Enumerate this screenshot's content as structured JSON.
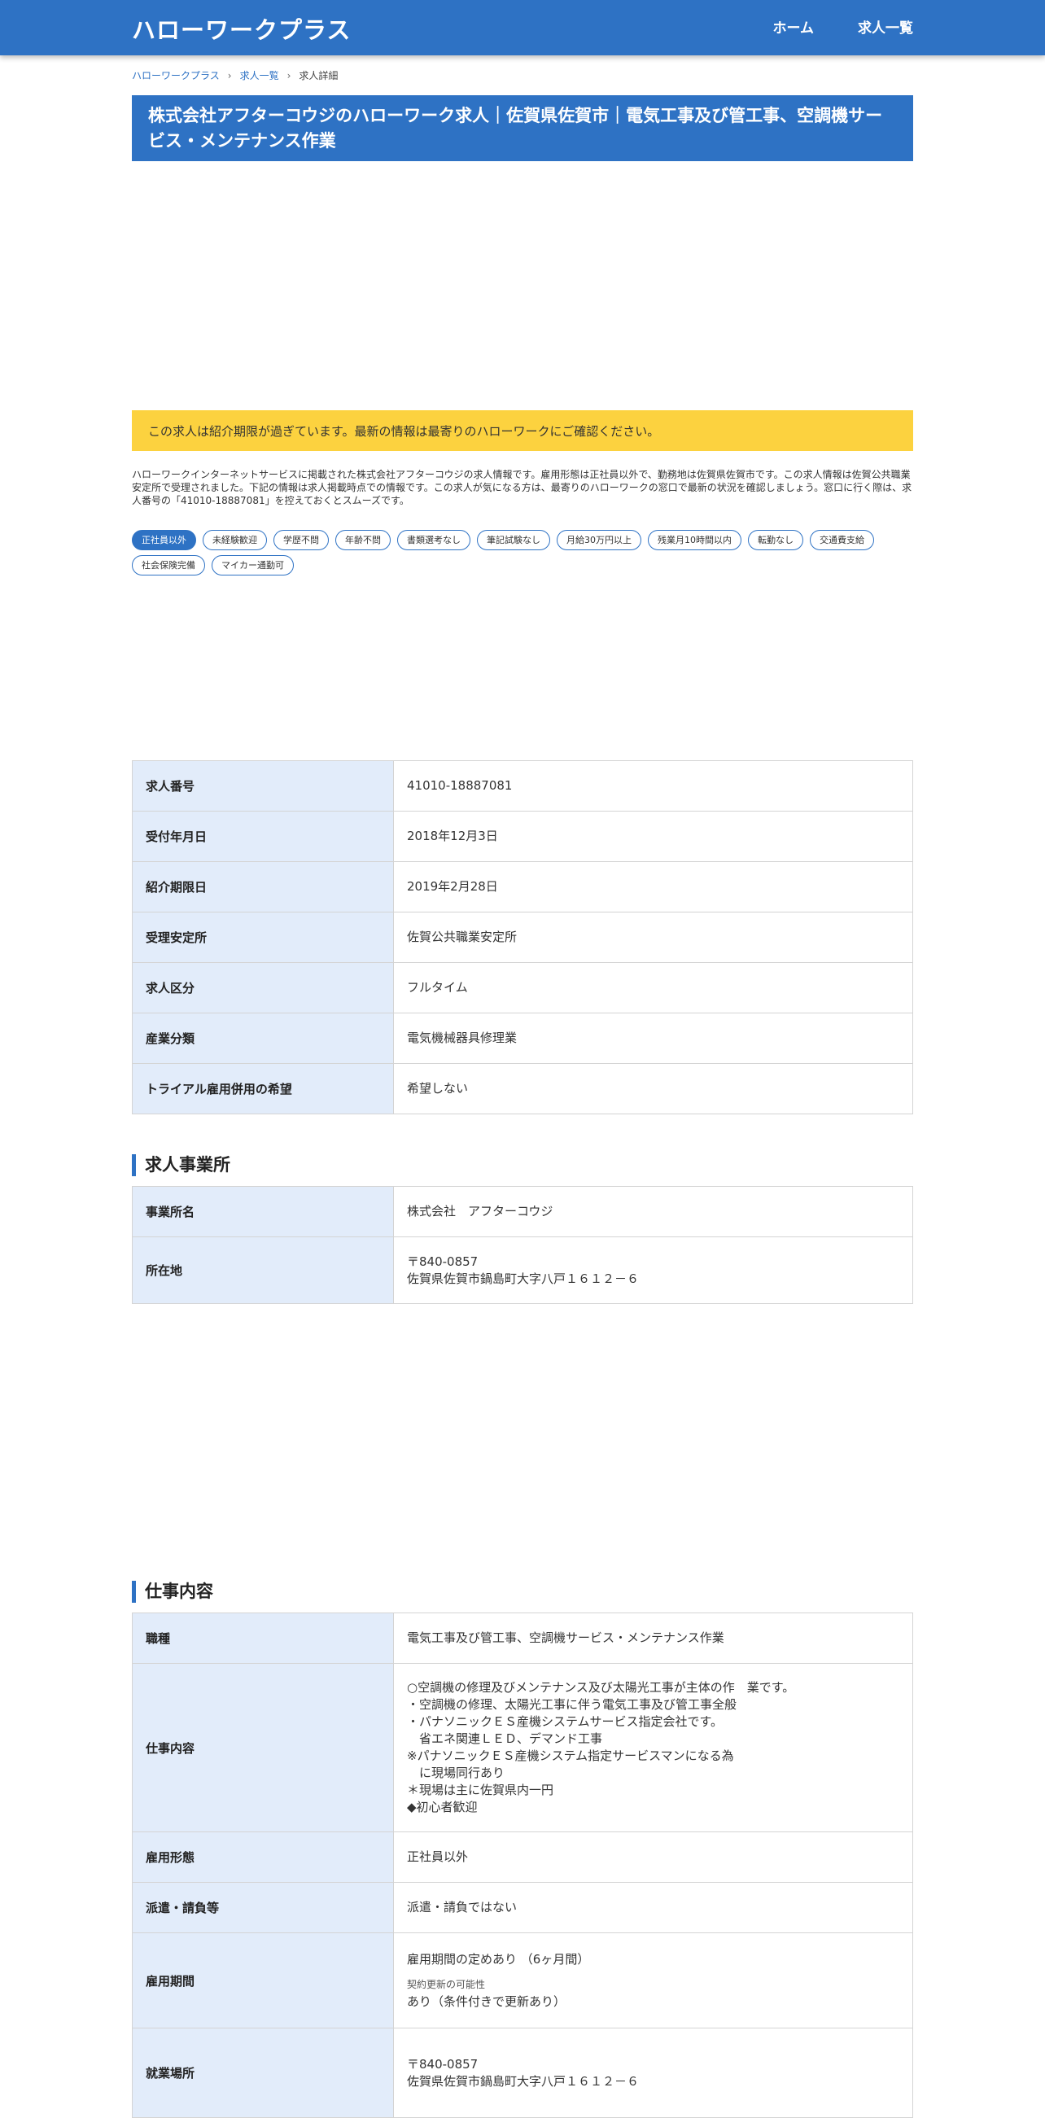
{
  "header": {
    "brand": "ハローワークプラス",
    "nav": [
      "ホーム",
      "求人一覧"
    ]
  },
  "breadcrumb": [
    "ハローワークプラス",
    "求人一覧",
    "求人詳細"
  ],
  "title": "株式会社アフターコウジのハローワーク求人｜佐賀県佐賀市｜電気工事及び管工事、空調機サービス・メンテナンス作業",
  "notice": "この求人は紹介期限が過ぎています。最新の情報は最寄りのハローワークにご確認ください。",
  "description": "ハローワークインターネットサービスに掲載された株式会社アフターコウジの求人情報です。雇用形態は正社員以外で、勤務地は佐賀県佐賀市です。この求人情報は佐賀公共職業安定所で受理されました。下記の情報は求人掲載時点での情報です。この求人が気になる方は、最寄りのハローワークの窓口で最新の状況を確認しましょう。窓口に行く際は、求人番号の「41010-18887081」を控えておくとスムーズです。",
  "tags": [
    "正社員以外",
    "未経験歓迎",
    "学歴不問",
    "年齢不問",
    "書類選考なし",
    "筆記試験なし",
    "月給30万円以上",
    "残業月10時間以内",
    "転勤なし",
    "交通費支給",
    "社会保険完備",
    "マイカー通勤可"
  ],
  "basic_table": {
    "rows": [
      {
        "label": "求人番号",
        "value": "41010-18887081"
      },
      {
        "label": "受付年月日",
        "value": "2018年12月3日"
      },
      {
        "label": "紹介期限日",
        "value": "2019年2月28日"
      },
      {
        "label": "受理安定所",
        "value": "佐賀公共職業安定所"
      },
      {
        "label": "求人区分",
        "value": "フルタイム"
      },
      {
        "label": "産業分類",
        "value": "電気機械器具修理業"
      },
      {
        "label": "トライアル雇用併用の希望",
        "value": "希望しない"
      }
    ]
  },
  "office": {
    "heading": "求人事業所",
    "name_label": "事業所名",
    "name": "株式会社　アフターコウジ",
    "address_label": "所在地",
    "postal": "〒840-0857",
    "address": "佐賀県佐賀市鍋島町大字八戸１６１２－６"
  },
  "job": {
    "heading": "仕事内容",
    "type_label": "職種",
    "type": "電気工事及び管工事、空調機サービス・メンテナンス作業",
    "content_label": "仕事内容",
    "content_lines": [
      "○空調機の修理及びメンテナンス及び太陽光工事が主体の作　業です。",
      "・空調機の修理、太陽光工事に伴う電気工事及び管工事全般",
      "・パナソニックＥＳ産機システムサービス指定会社です。",
      "　省エネ関連ＬＥＤ、デマンド工事",
      "※パナソニックＥＳ産機システム指定サービスマンになる為",
      "　に現場同行あり",
      "＊現場は主に佐賀県内一円",
      "◆初心者歓迎"
    ],
    "employment_label": "雇用形態",
    "employment": "正社員以外",
    "dispatch_label": "派遣・請負等",
    "dispatch": "派遣・請負ではない",
    "period_label": "雇用期間",
    "period": "雇用期間の定めあり （6ヶ月間）",
    "renewal_label": "契約更新の可能性",
    "renewal": "あり（条件付きで更新あり）",
    "location_label": "就業場所",
    "location_postal": "〒840-0857",
    "location_address": "佐賀県佐賀市鍋島町大字八戸１６１２－６"
  }
}
